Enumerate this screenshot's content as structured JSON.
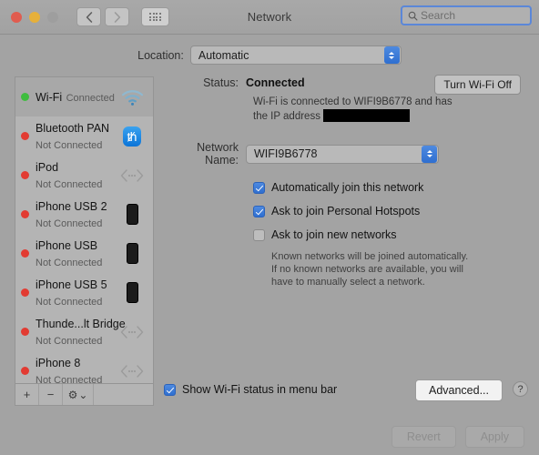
{
  "window": {
    "title": "Network",
    "traffic_lights": [
      "close",
      "minimize",
      "zoom"
    ],
    "back_icon": "chevron-left-icon",
    "forward_icon": "chevron-right-icon",
    "grid_icon": "show-all-icon"
  },
  "search": {
    "value": "",
    "placeholder": "Search",
    "icon": "search-icon"
  },
  "location": {
    "label": "Location:",
    "value": "Automatic"
  },
  "sidebar": {
    "items": [
      {
        "name": "Wi-Fi",
        "status": "Connected",
        "dot": "green",
        "icon": "wifi-icon",
        "selected": true
      },
      {
        "name": "Bluetooth PAN",
        "status": "Not Connected",
        "dot": "red",
        "icon": "bluetooth-icon",
        "selected": false
      },
      {
        "name": "iPod",
        "status": "Not Connected",
        "dot": "red",
        "icon": "thunderbolt-icon",
        "selected": false
      },
      {
        "name": "iPhone USB 2",
        "status": "Not Connected",
        "dot": "red",
        "icon": "iphone-icon",
        "selected": false
      },
      {
        "name": "iPhone USB",
        "status": "Not Connected",
        "dot": "red",
        "icon": "iphone-icon",
        "selected": false
      },
      {
        "name": "iPhone USB 5",
        "status": "Not Connected",
        "dot": "red",
        "icon": "iphone-icon",
        "selected": false
      },
      {
        "name": "Thunde...lt Bridge",
        "status": "Not Connected",
        "dot": "red",
        "icon": "thunderbolt-icon",
        "selected": false
      },
      {
        "name": "iPhone 8",
        "status": "Not Connected",
        "dot": "red",
        "icon": "thunderbolt-icon",
        "selected": false
      }
    ],
    "footer": {
      "add": "+",
      "remove": "−",
      "gear": "⚙",
      "gear_caret": "⌄"
    }
  },
  "main": {
    "status_label": "Status:",
    "status_value": "Connected",
    "turn_off_button": "Turn Wi-Fi Off",
    "description_prefix": "Wi-Fi is connected to WIFI9B6778 and has the IP address ",
    "description_redacted": true,
    "network_name_label": "Network Name:",
    "network_name_value": "WIFI9B6778",
    "checkboxes": [
      {
        "label": "Automatically join this network",
        "checked": true
      },
      {
        "label": "Ask to join Personal Hotspots",
        "checked": true
      },
      {
        "label": "Ask to join new networks",
        "checked": false
      }
    ],
    "hint": "Known networks will be joined automatically. If no known networks are available, you will have to manually select a network.",
    "show_status_checkbox": {
      "label": "Show Wi-Fi status in menu bar",
      "checked": true
    },
    "advanced_button": "Advanced...",
    "help_button": "?"
  },
  "footer": {
    "revert": "Revert",
    "apply": "Apply",
    "revert_enabled": false,
    "apply_enabled": false
  },
  "colors": {
    "accent_blue": "#3c7ad8",
    "window_bg": "#a3a3a3",
    "sidebar_bg": "#b4b4b4",
    "connected_green": "#3fbd3f",
    "disconnected_red": "#e23b32"
  }
}
